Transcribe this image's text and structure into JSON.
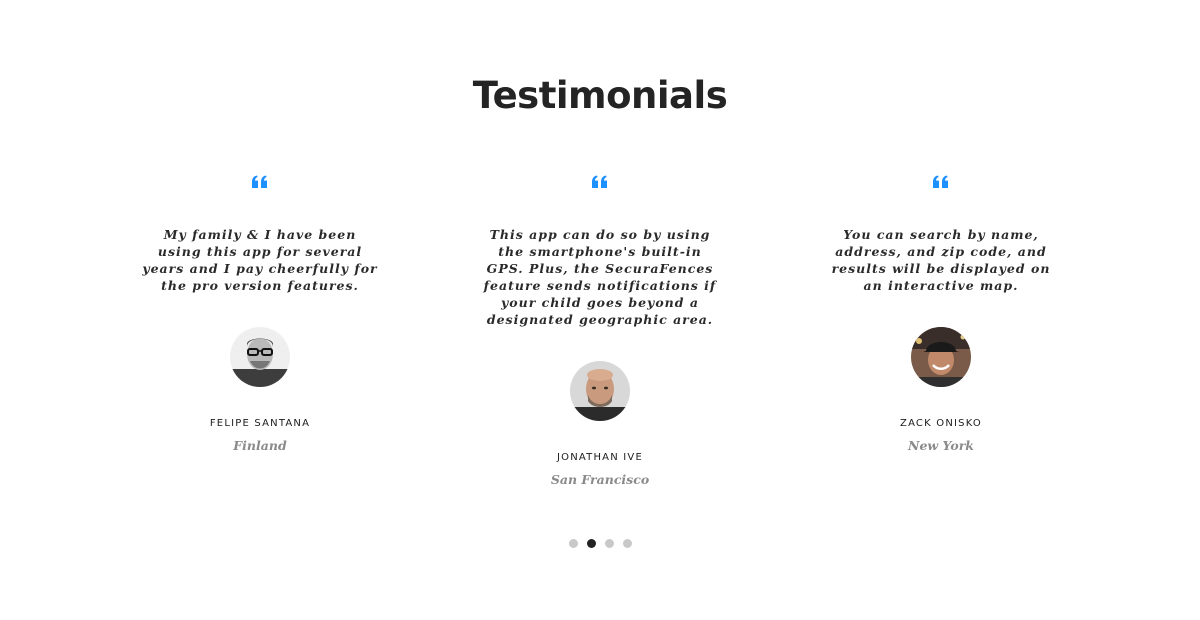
{
  "section": {
    "title": "Testimonials"
  },
  "colors": {
    "accent": "#1e90ff",
    "title": "#242424",
    "muted": "#8a8a8a",
    "dot_inactive": "#c8c8c8",
    "dot_active": "#222222"
  },
  "testimonials": [
    {
      "quote": "My family & I have been using this app for several years and I pay cheerfully for the pro version features.",
      "name": "FELIPE SANTANA",
      "location": "Finland",
      "icon": "quote-icon"
    },
    {
      "quote": "This app can do so by using the smartphone's built-in GPS. Plus, the SecuraFences feature sends notifications if your child goes beyond a designated geographic area.",
      "name": "JONATHAN IVE",
      "location": "San Francisco",
      "icon": "quote-icon"
    },
    {
      "quote": "You can search by name, address, and zip code, and results will be displayed on an interactive map.",
      "name": "ZACK ONISKO",
      "location": "New York",
      "icon": "quote-icon"
    }
  ],
  "pagination": {
    "count": 4,
    "active_index": 1
  }
}
